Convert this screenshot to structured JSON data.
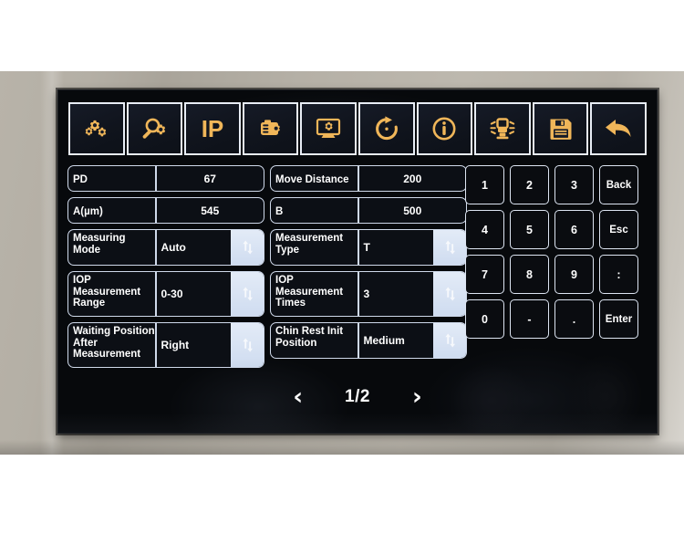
{
  "device": {
    "bezel_color": "#b5b0a6",
    "screen_background": "#07090c"
  },
  "toolbar": {
    "accent_color": "#f0b659",
    "buttons": [
      {
        "name": "gears-icon",
        "label": "",
        "icon": "gears-icon"
      },
      {
        "name": "magnifier-gear-icon",
        "label": "",
        "icon": "magnifier-gear-icon"
      },
      {
        "name": "ip-icon",
        "label": "IP",
        "icon": "ip-text-icon"
      },
      {
        "name": "device-gear-icon",
        "label": "",
        "icon": "device-gear-icon"
      },
      {
        "name": "monitor-gear-icon",
        "label": "",
        "icon": "monitor-gear-icon"
      },
      {
        "name": "refresh-icon",
        "label": "",
        "icon": "refresh-icon"
      },
      {
        "name": "info-icon",
        "label": "",
        "icon": "info-circle-icon"
      },
      {
        "name": "lamp-icon",
        "label": "",
        "icon": "lamp-rays-icon"
      },
      {
        "name": "save-icon",
        "label": "",
        "icon": "floppy-save-icon"
      },
      {
        "name": "back-icon",
        "label": "",
        "icon": "back-arrow-icon"
      }
    ]
  },
  "settings": {
    "left_column": [
      {
        "label": "PD",
        "value": "67",
        "type": "numeric",
        "lines": 1,
        "align": "center",
        "spinner": false
      },
      {
        "label": "A(µm)",
        "value": "545",
        "type": "numeric",
        "lines": 1,
        "align": "center",
        "spinner": false
      },
      {
        "label": "Measuring Mode",
        "value": "Auto",
        "type": "select",
        "lines": 2,
        "align": "left",
        "spinner": true
      },
      {
        "label": "IOP Measurement Range",
        "value": "0-30",
        "type": "select",
        "lines": 3,
        "align": "left",
        "spinner": true
      },
      {
        "label": "Waiting Position After Measurement",
        "value": "Right",
        "type": "select",
        "lines": 3,
        "align": "left",
        "spinner": true
      }
    ],
    "middle_column": [
      {
        "label": "Move Distance",
        "value": "200",
        "type": "numeric",
        "lines": 1,
        "align": "center",
        "spinner": false
      },
      {
        "label": "B",
        "value": "500",
        "type": "numeric",
        "lines": 1,
        "align": "center",
        "spinner": false
      },
      {
        "label": "Measurement Type",
        "value": "T",
        "type": "select",
        "lines": 2,
        "align": "left",
        "spinner": true
      },
      {
        "label": "IOP Measurement Times",
        "value": "3",
        "type": "select",
        "lines": 3,
        "align": "left",
        "spinner": true
      },
      {
        "label": "Chin Rest Init Position",
        "value": "Medium",
        "type": "select",
        "lines": 2,
        "align": "left",
        "spinner": true
      }
    ]
  },
  "keypad": {
    "keys": [
      {
        "label": "1",
        "name": "key-1"
      },
      {
        "label": "2",
        "name": "key-2"
      },
      {
        "label": "3",
        "name": "key-3"
      },
      {
        "label": "Back",
        "name": "key-back"
      },
      {
        "label": "4",
        "name": "key-4"
      },
      {
        "label": "5",
        "name": "key-5"
      },
      {
        "label": "6",
        "name": "key-6"
      },
      {
        "label": "Esc",
        "name": "key-esc"
      },
      {
        "label": "7",
        "name": "key-7"
      },
      {
        "label": "8",
        "name": "key-8"
      },
      {
        "label": "9",
        "name": "key-9"
      },
      {
        "label": ":",
        "name": "key-colon"
      },
      {
        "label": "0",
        "name": "key-0"
      },
      {
        "label": "-",
        "name": "key-minus"
      },
      {
        "label": ".",
        "name": "key-dot"
      },
      {
        "label": "Enter",
        "name": "key-enter"
      }
    ]
  },
  "pager": {
    "prev": "‹",
    "next": "›",
    "label": "1/2",
    "current_page": 1,
    "total_pages": 2
  }
}
